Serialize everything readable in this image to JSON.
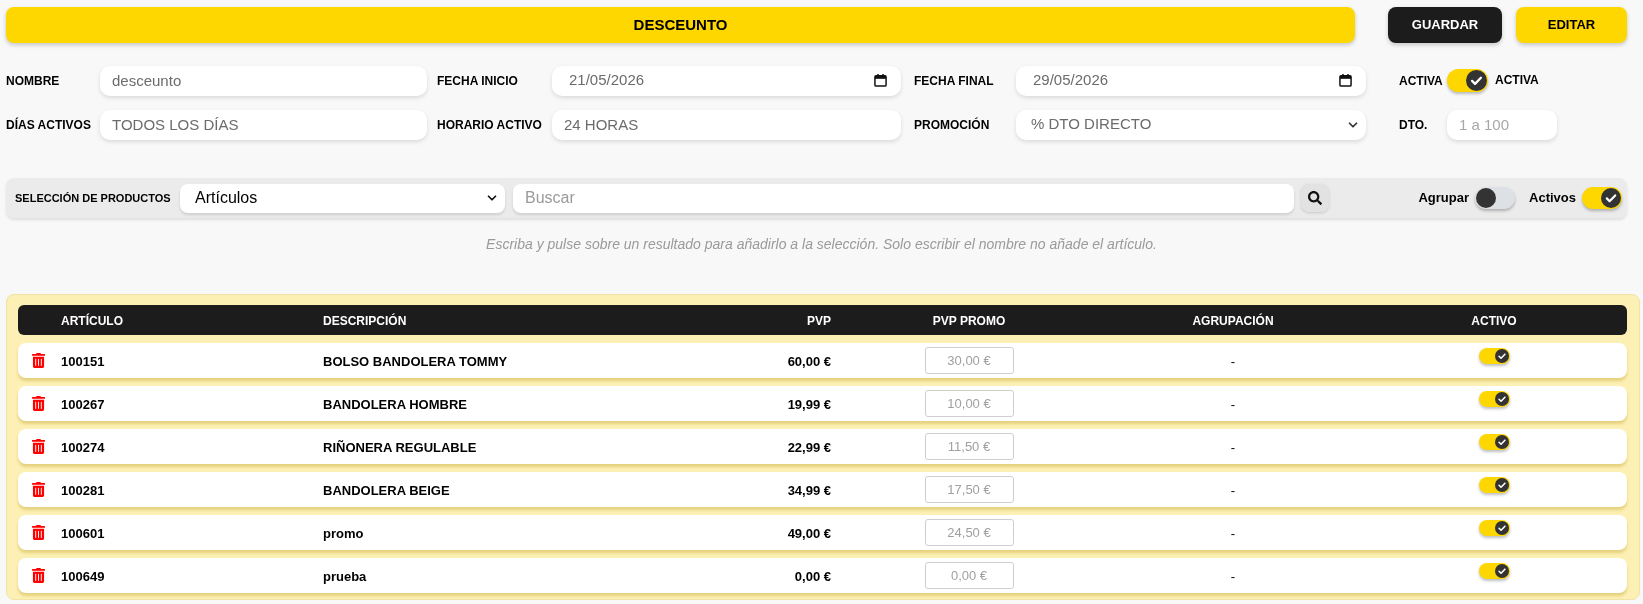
{
  "header": {
    "title": "DESCEUNTO",
    "buttons": [
      {
        "label": "GUARDAR",
        "kind": "dark"
      },
      {
        "label": "EDITAR",
        "kind": "accent"
      }
    ]
  },
  "form": {
    "rows": [
      [
        {
          "label": "NOMBRE",
          "kind": "text",
          "value": "desceunto"
        },
        {
          "label": "FECHA INICIO",
          "kind": "date",
          "value": "21/05/2026"
        },
        {
          "label": "FECHA FINAL",
          "kind": "date",
          "value": "29/05/2026"
        },
        {
          "label": "ACTIVA",
          "kind": "toggle",
          "on": true,
          "caption": "ACTIVA"
        }
      ],
      [
        {
          "label": "DÍAS ACTIVOS",
          "kind": "text",
          "value": "TODOS LOS DÍAS"
        },
        {
          "label": "HORARIO ACTIVO",
          "kind": "text",
          "value": "24 HORAS"
        },
        {
          "label": "PROMOCIÓN",
          "kind": "select",
          "value": "% DTO DIRECTO"
        },
        {
          "label": "DTO.",
          "kind": "text",
          "placeholder": "1 a 100"
        }
      ]
    ]
  },
  "product_selection": {
    "label": "SELECCIÓN DE PRODUCTOS",
    "select": {
      "value": "Artículos"
    },
    "search": {
      "placeholder": "Buscar"
    },
    "toggles": [
      {
        "label": "Agrupar",
        "on": false
      },
      {
        "label": "Activos",
        "on": true
      }
    ],
    "hint": "Escriba y pulse sobre un resultado para añadirlo a la selección. Solo escribir el nombre no añade el artículo."
  },
  "table": {
    "columns": [
      "ARTÍCULO",
      "DESCRIPCIÓN",
      "PVP",
      "PVP PROMO",
      "AGRUPACIÓN",
      "ACTIVO"
    ],
    "rows": [
      {
        "articulo": "100151",
        "descripcion": "BOLSO BANDOLERA TOMMY",
        "pvp": "60,00 €",
        "pvp_promo": {
          "placeholder": "30,00 €"
        },
        "agrupacion": "-",
        "activo": true
      },
      {
        "articulo": "100267",
        "descripcion": "BANDOLERA HOMBRE",
        "pvp": "19,99 €",
        "pvp_promo": {
          "placeholder": "10,00 €"
        },
        "agrupacion": "-",
        "activo": true
      },
      {
        "articulo": "100274",
        "descripcion": "RIÑONERA REGULABLE",
        "pvp": "22,99 €",
        "pvp_promo": {
          "placeholder": "11,50 €"
        },
        "agrupacion": "-",
        "activo": true
      },
      {
        "articulo": "100281",
        "descripcion": "BANDOLERA BEIGE",
        "pvp": "34,99 €",
        "pvp_promo": {
          "placeholder": "17,50 €"
        },
        "agrupacion": "-",
        "activo": true
      },
      {
        "articulo": "100601",
        "descripcion": "promo",
        "pvp": "49,00 €",
        "pvp_promo": {
          "placeholder": "24,50 €"
        },
        "agrupacion": "-",
        "activo": true
      },
      {
        "articulo": "100649",
        "descripcion": "prueba",
        "pvp": "0,00 €",
        "pvp_promo": {
          "placeholder": "0,00 €"
        },
        "agrupacion": "-",
        "activo": true
      }
    ]
  }
}
